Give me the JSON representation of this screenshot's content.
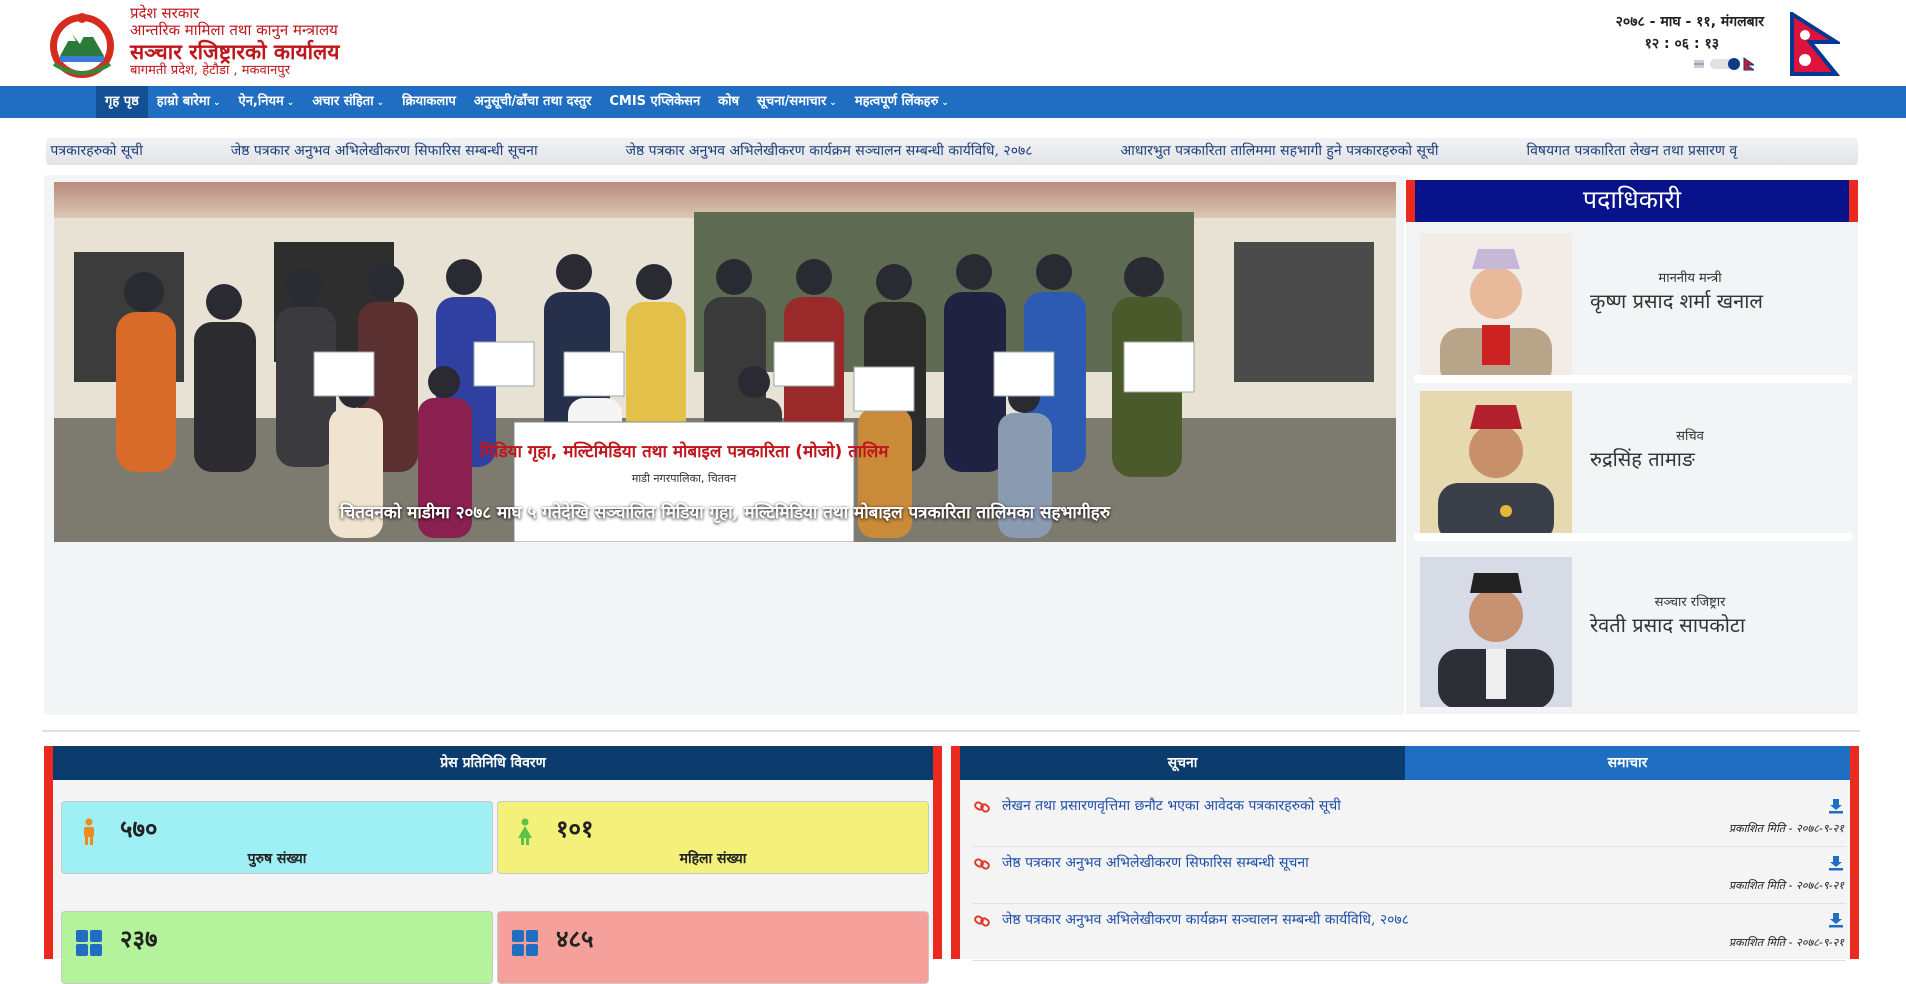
{
  "header": {
    "line1": "प्रदेश सरकार",
    "line2": "आन्तरिक मामिला तथा कानुन मन्त्रालय",
    "office": "सञ्चार रजिष्ट्रारको कार्यालय",
    "address": "बागमती प्रदेश, हेटौडा , मकवानपुर",
    "date": "२०७८ - माघ - ११, मंगलबार",
    "time": "१२ : ०६ : १३"
  },
  "nav": {
    "items": [
      {
        "label": "गृह पृष्ठ",
        "dropdown": false
      },
      {
        "label": "हाम्रो बारेमा",
        "dropdown": true
      },
      {
        "label": "ऐन,नियम",
        "dropdown": true
      },
      {
        "label": "अचार संहिता",
        "dropdown": true
      },
      {
        "label": "क्रियाकलाप",
        "dropdown": false
      },
      {
        "label": "अनुसूची/ढाँचा तथा दस्तुर",
        "dropdown": false
      },
      {
        "label": "CMIS एप्लिकेसन",
        "dropdown": false
      },
      {
        "label": "कोष",
        "dropdown": false
      },
      {
        "label": "सूचना/समाचार",
        "dropdown": true
      },
      {
        "label": "महत्वपूर्ण लिंकहरु",
        "dropdown": true
      }
    ],
    "caret": "⌄"
  },
  "ticker": {
    "items": [
      "वेदक पत्रकारहरुको सूची",
      "जेष्ठ पत्रकार अनुभव अभिलेखीकरण सिफारिस सम्बन्धी सूचना",
      "जेष्ठ पत्रकार अनुभव अभिलेखीकरण कार्यक्रम सञ्चालन सम्बन्धी कार्यविधि, २०७८",
      "आधारभुत पत्रकारिता तालिममा सहभागी हुने पत्रकारहरुको सूची",
      "विषयगत पत्रकारिता लेखन तथा प्रसारण वृ"
    ]
  },
  "slider": {
    "caption": "चितवनको माडीमा २०७८ माघ ५ गतेदेखि सञ्चालित मिडिया गृहा, मल्टिमिडिया तथा मोबाइल पत्रकारिता तालिमका सहभागीहरु",
    "banner_text": "मिडिया गृहा, मल्टिमिडिया तथा मोबाइल पत्रकारिता (मोजो) तालिम",
    "banner_sub": "माडी नगरपालिका, चितवन"
  },
  "officials": {
    "heading": "पदाधिकारी",
    "people": [
      {
        "role": "माननीय मन्त्री",
        "name": "कृष्ण प्रसाद शर्मा खनाल"
      },
      {
        "role": "सचिव",
        "name": "रुद्रसिंह तामाङ"
      },
      {
        "role": "सञ्चार रजिष्ट्रार",
        "name": "रेवती प्रसाद सापकोटा"
      }
    ]
  },
  "press": {
    "heading": "प्रेस प्रतिनिधि विवरण",
    "stats": [
      {
        "value": "५७०",
        "label": "पुरुष संख्या",
        "color": "#9ef0f5",
        "icon": "male-person-icon"
      },
      {
        "value": "१०१",
        "label": "महिला संख्या",
        "color": "#f3f17a",
        "icon": "female-person-icon"
      },
      {
        "value": "२३७",
        "label": "",
        "color": "#b4f29b",
        "icon": "grid-icon"
      },
      {
        "value": "४८५",
        "label": "",
        "color": "#f5a09a",
        "icon": "grid-icon"
      }
    ]
  },
  "notices": {
    "tabs": [
      "सूचना",
      "समाचार"
    ],
    "items": [
      {
        "title": "लेखन तथा प्रसारणवृत्तिमा छनौट भएका आवेदक पत्रकारहरुको सूची",
        "date": "प्रकाशित मिति - २०७८-९-२१"
      },
      {
        "title": "जेष्ठ पत्रकार अनुभव अभिलेखीकरण सिफारिस सम्बन्धी सूचना",
        "date": "प्रकाशित मिति - २०७८-९-२१"
      },
      {
        "title": "जेष्ठ पत्रकार अनुभव अभिलेखीकरण कार्यक्रम सञ्चालन सम्बन्धी कार्यविधि, २०७८",
        "date": "प्रकाशित मिति - २०७८-९-२१"
      }
    ]
  },
  "colors": {
    "nav_blue": "#1f6ec2",
    "dark_navy": "#0b3c6d",
    "officials_head": "#08128a",
    "accent_red": "#ea2a1f",
    "brand_red": "#c0161b"
  }
}
